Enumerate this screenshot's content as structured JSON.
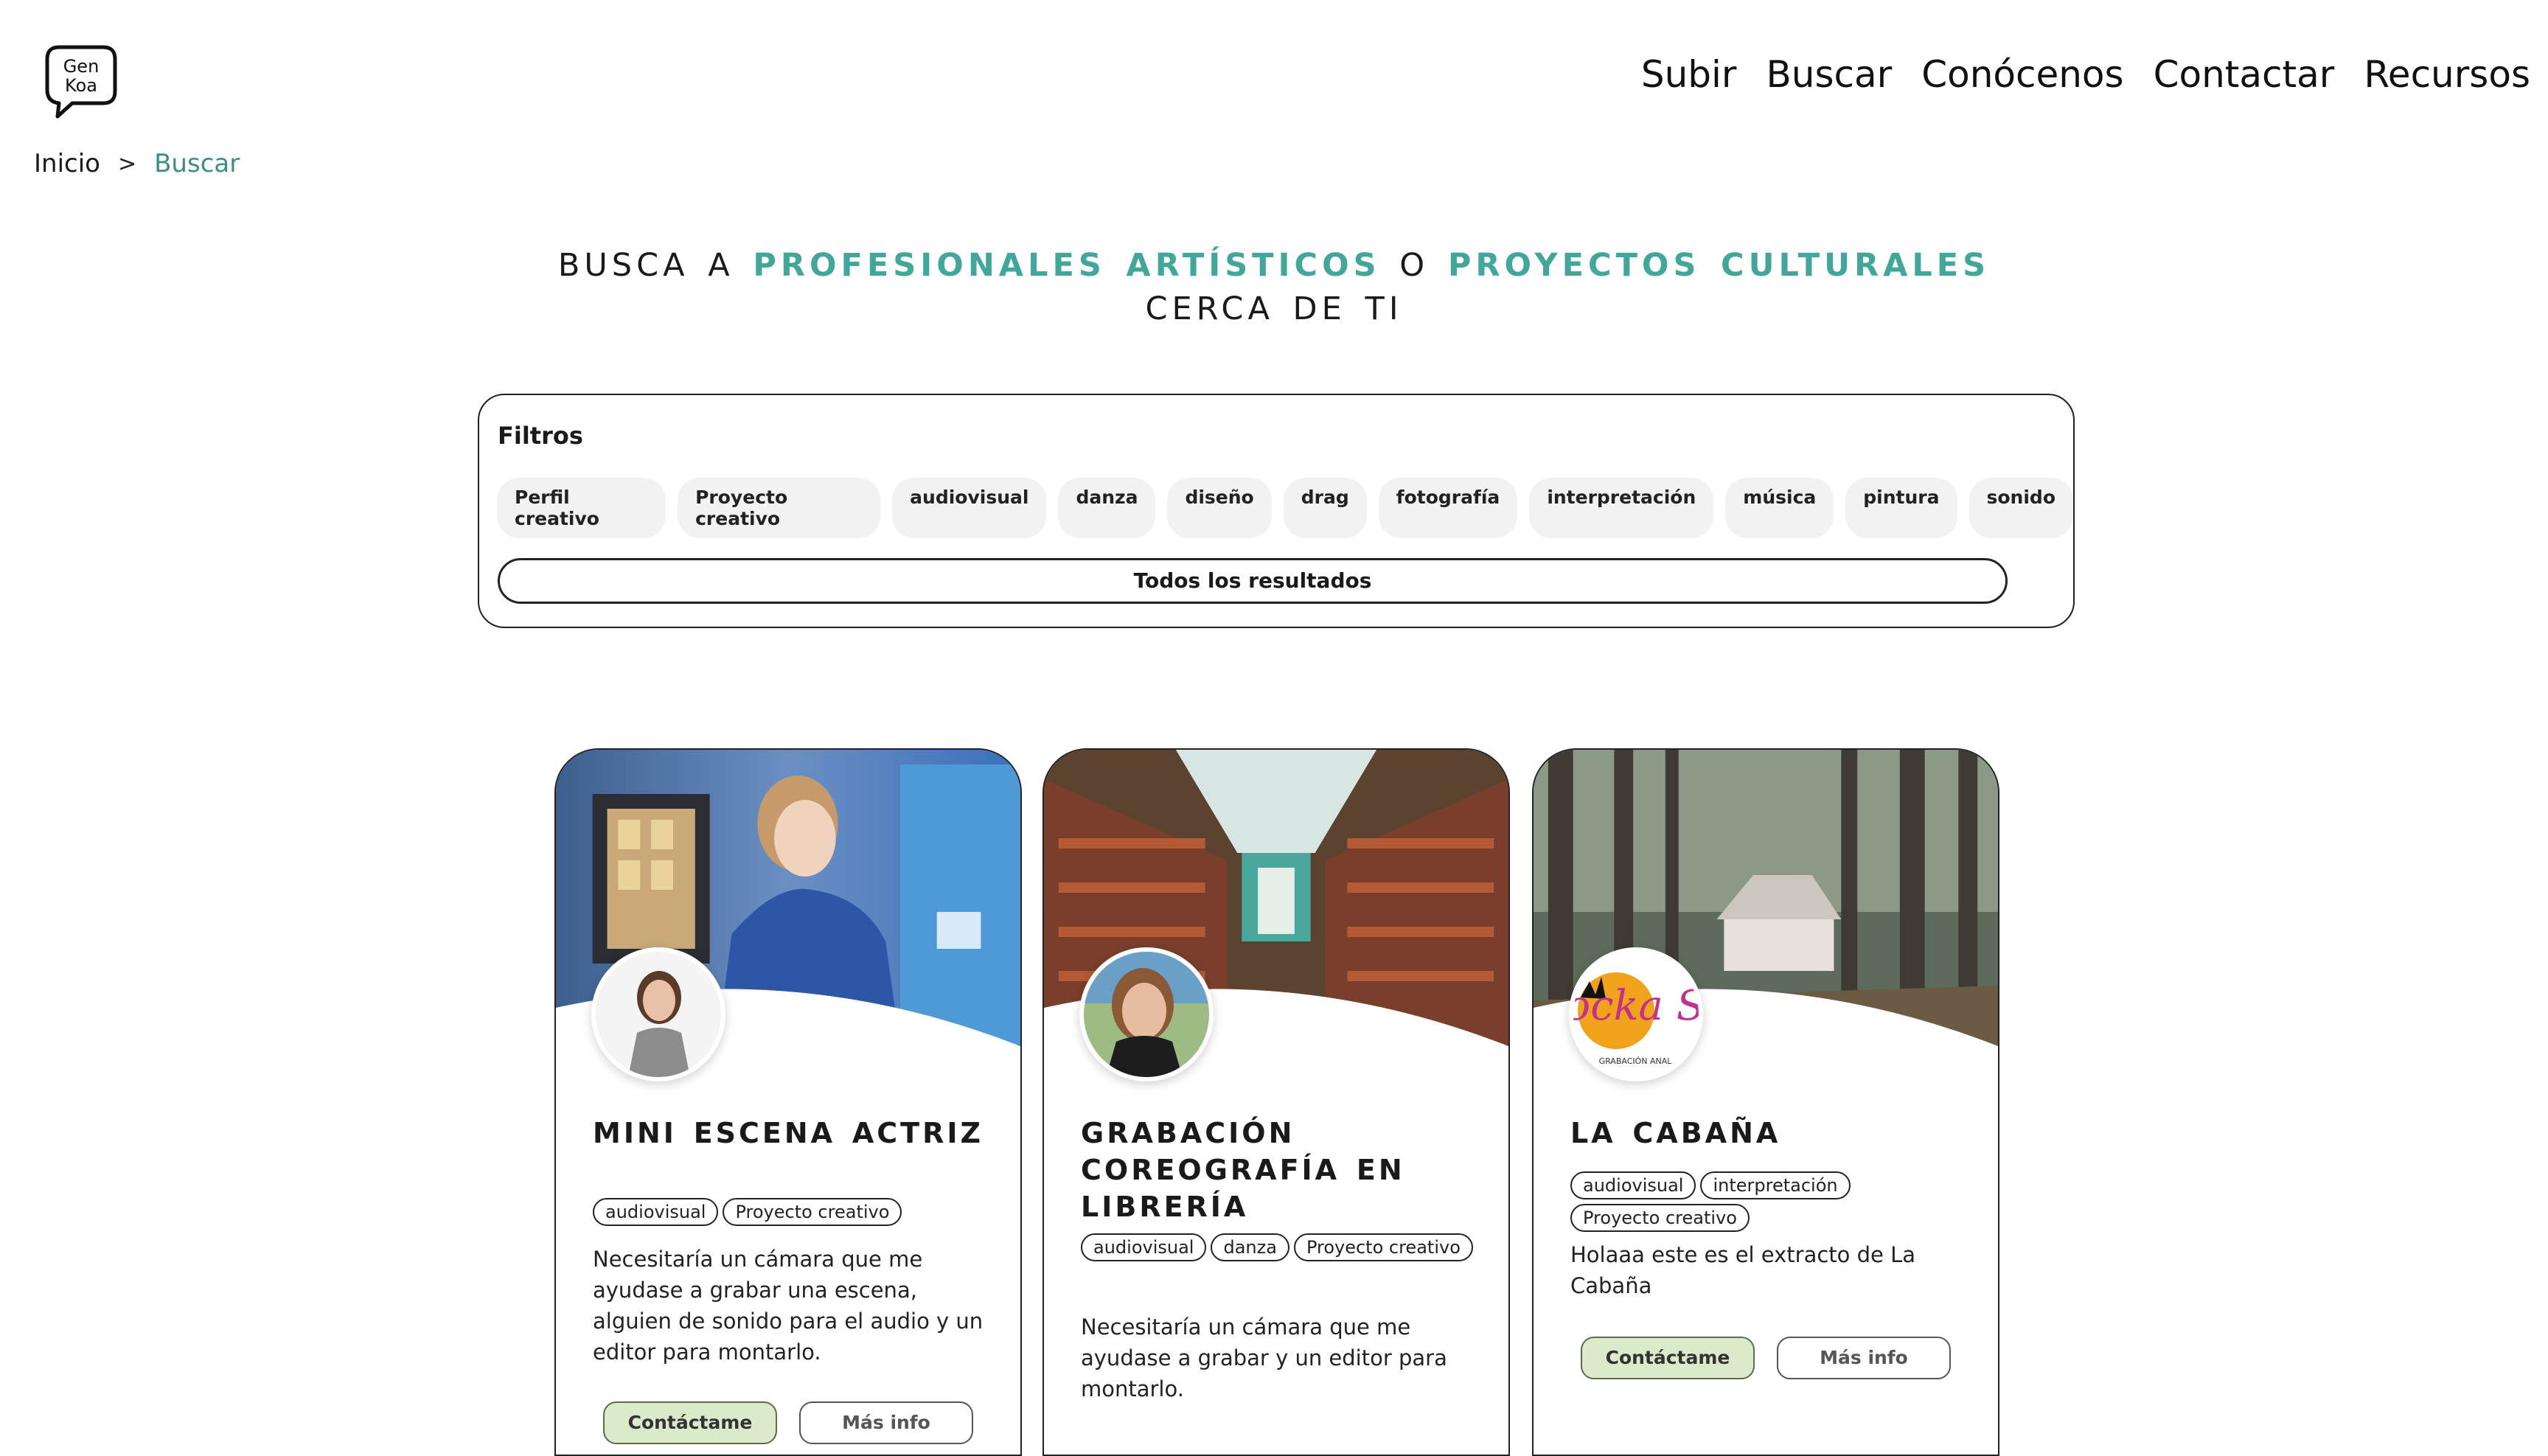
{
  "header": {
    "logo_text": [
      "Gen",
      "Koa"
    ],
    "nav": [
      "Subir",
      "Buscar",
      "Conócenos",
      "Contactar",
      "Recursos"
    ]
  },
  "breadcrumb": {
    "home": "Inicio",
    "separator": ">",
    "current": "Buscar"
  },
  "hero": {
    "part1": "Busca a ",
    "accent1": "profesionales artísticos",
    "part2": " o ",
    "accent2": "proyectos culturales",
    "line2": "cerca de ti"
  },
  "filters": {
    "title": "Filtros",
    "chips": [
      "Perfil creativo",
      "Proyecto creativo",
      "audiovisual",
      "danza",
      "diseño",
      "drag",
      "fotografía",
      "interpretación",
      "música",
      "pintura",
      "sonido"
    ],
    "all_results": "Todos los resultados"
  },
  "cards": [
    {
      "title": "Mini escena actriz",
      "tags": [
        "audiovisual",
        "Proyecto creativo"
      ],
      "description": "Necesitaría un cámara que me ayudase a grabar una escena, alguien de sonido para el audio y un editor para montarlo.",
      "contact_label": "Contáctame",
      "info_label": "Más info"
    },
    {
      "title": "Grabación coreografía en librería",
      "tags": [
        "audiovisual",
        "danza",
        "Proyecto creativo"
      ],
      "description": "Necesitaría un cámara que me ayudase a grabar y un editor para montarlo.",
      "contact_label": "Contáctame",
      "info_label": "Más info"
    },
    {
      "title": "La cabaña",
      "tags": [
        "audiovisual",
        "interpretación",
        "Proyecto creativo"
      ],
      "description": "Holaaa este es el extracto de La Cabaña",
      "contact_label": "Contáctame",
      "info_label": "Más info",
      "avatar_logo_text": "Rocka Stu",
      "avatar_logo_subtext": "GRABACIÓN ANAL"
    }
  ],
  "colors": {
    "accent": "#40a79a",
    "breadcrumb_active": "#3a8f84",
    "contact_bg": "#dbeac9"
  }
}
